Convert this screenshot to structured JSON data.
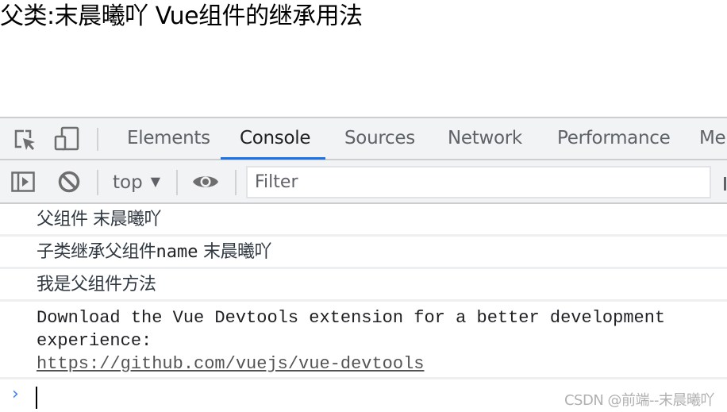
{
  "page": {
    "heading": "父类:末晨曦吖 Vue组件的继承用法"
  },
  "devtools": {
    "toolbar_icons": {
      "inspect": "inspect-element-icon",
      "device": "device-toolbar-icon"
    },
    "tabs": [
      {
        "label": "Elements",
        "active": false
      },
      {
        "label": "Console",
        "active": true
      },
      {
        "label": "Sources",
        "active": false
      },
      {
        "label": "Network",
        "active": false
      },
      {
        "label": "Performance",
        "active": false
      },
      {
        "label": "Me",
        "active": false
      }
    ],
    "accent_color": "#1a73e8",
    "console_toolbar": {
      "sidebar_icon": "show-console-sidebar-icon",
      "clear_icon": "clear-console-icon",
      "context": "top",
      "eye_icon": "live-expression-icon",
      "filter_placeholder": "Filter"
    },
    "console": {
      "messages": [
        {
          "text": "父组件  末晨曦吖"
        },
        {
          "prefix": "子类继承父组件",
          "mono": "name",
          "suffix": " 末晨曦吖"
        },
        {
          "text": "我是父组件方法"
        },
        {
          "line1": "Download the Vue Devtools extension for a better development",
          "line2": "experience:",
          "link": "https://github.com/vuejs/vue-devtools"
        }
      ],
      "prompt_symbol": "›"
    }
  },
  "watermark": "CSDN @前端--末晨曦吖"
}
